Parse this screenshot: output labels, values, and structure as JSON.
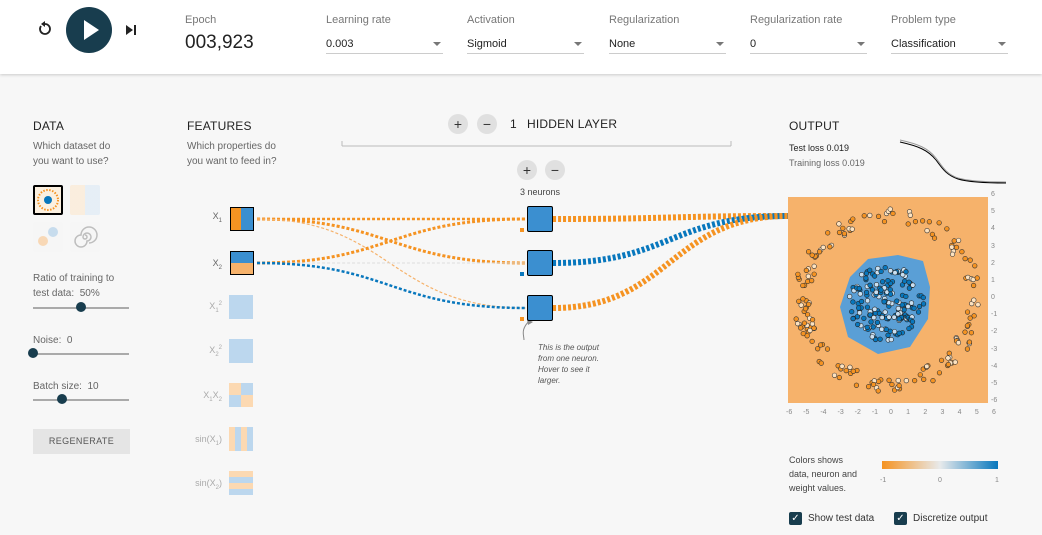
{
  "header": {
    "epoch_label": "Epoch",
    "epoch_value": "003,923",
    "learning_rate": {
      "label": "Learning rate",
      "value": "0.003"
    },
    "activation": {
      "label": "Activation",
      "value": "Sigmoid"
    },
    "regularization": {
      "label": "Regularization",
      "value": "None"
    },
    "regularization_rate": {
      "label": "Regularization rate",
      "value": "0"
    },
    "problem_type": {
      "label": "Problem type",
      "value": "Classification"
    }
  },
  "data": {
    "title": "DATA",
    "question_line1": "Which dataset do",
    "question_line2": "you want to use?",
    "ratio_line1": "Ratio of training to",
    "ratio_label": "test data:",
    "ratio_value": "50%",
    "ratio_fraction": 0.5,
    "noise_label": "Noise:",
    "noise_value": "0",
    "noise_fraction": 0.0,
    "batch_label": "Batch size:",
    "batch_value": "10",
    "batch_fraction": 0.3,
    "regenerate": "REGENERATE"
  },
  "features": {
    "title": "FEATURES",
    "question_line1": "Which properties do",
    "question_line2": "you want to feed in?",
    "items": [
      {
        "label": "X",
        "sub": "1",
        "sup": ""
      },
      {
        "label": "X",
        "sub": "2",
        "sup": ""
      },
      {
        "label": "X",
        "sub": "1",
        "sup": "2"
      },
      {
        "label": "X",
        "sub": "2",
        "sup": "2"
      },
      {
        "label": "X",
        "sub": "1",
        "label2": "X",
        "sub2": "2"
      },
      {
        "label": "sin(X",
        "sub": "1",
        "tail": ")"
      },
      {
        "label": "sin(X",
        "sub": "2",
        "tail": ")"
      }
    ]
  },
  "hidden": {
    "count": "1",
    "title": "HIDDEN LAYER",
    "neurons": "3 neurons",
    "tooltip": [
      "This is the output",
      "from one neuron.",
      "Hover to see it",
      "larger."
    ]
  },
  "output": {
    "title": "OUTPUT",
    "test_loss": "Test loss 0.019",
    "training_loss": "Training loss 0.019",
    "legend_text": [
      "Colors shows",
      "data, neuron and",
      "weight values."
    ],
    "legend_ticks": [
      "-1",
      "0",
      "1"
    ],
    "axis_ticks": [
      "-6",
      "-5",
      "-4",
      "-3",
      "-2",
      "-1",
      "0",
      "1",
      "2",
      "3",
      "4",
      "5",
      "6"
    ],
    "show_test": "Show test data",
    "discretize": "Discretize output"
  },
  "colors": {
    "orange": "#f59322",
    "blue": "#0877bd",
    "dark": "#183d4e"
  }
}
